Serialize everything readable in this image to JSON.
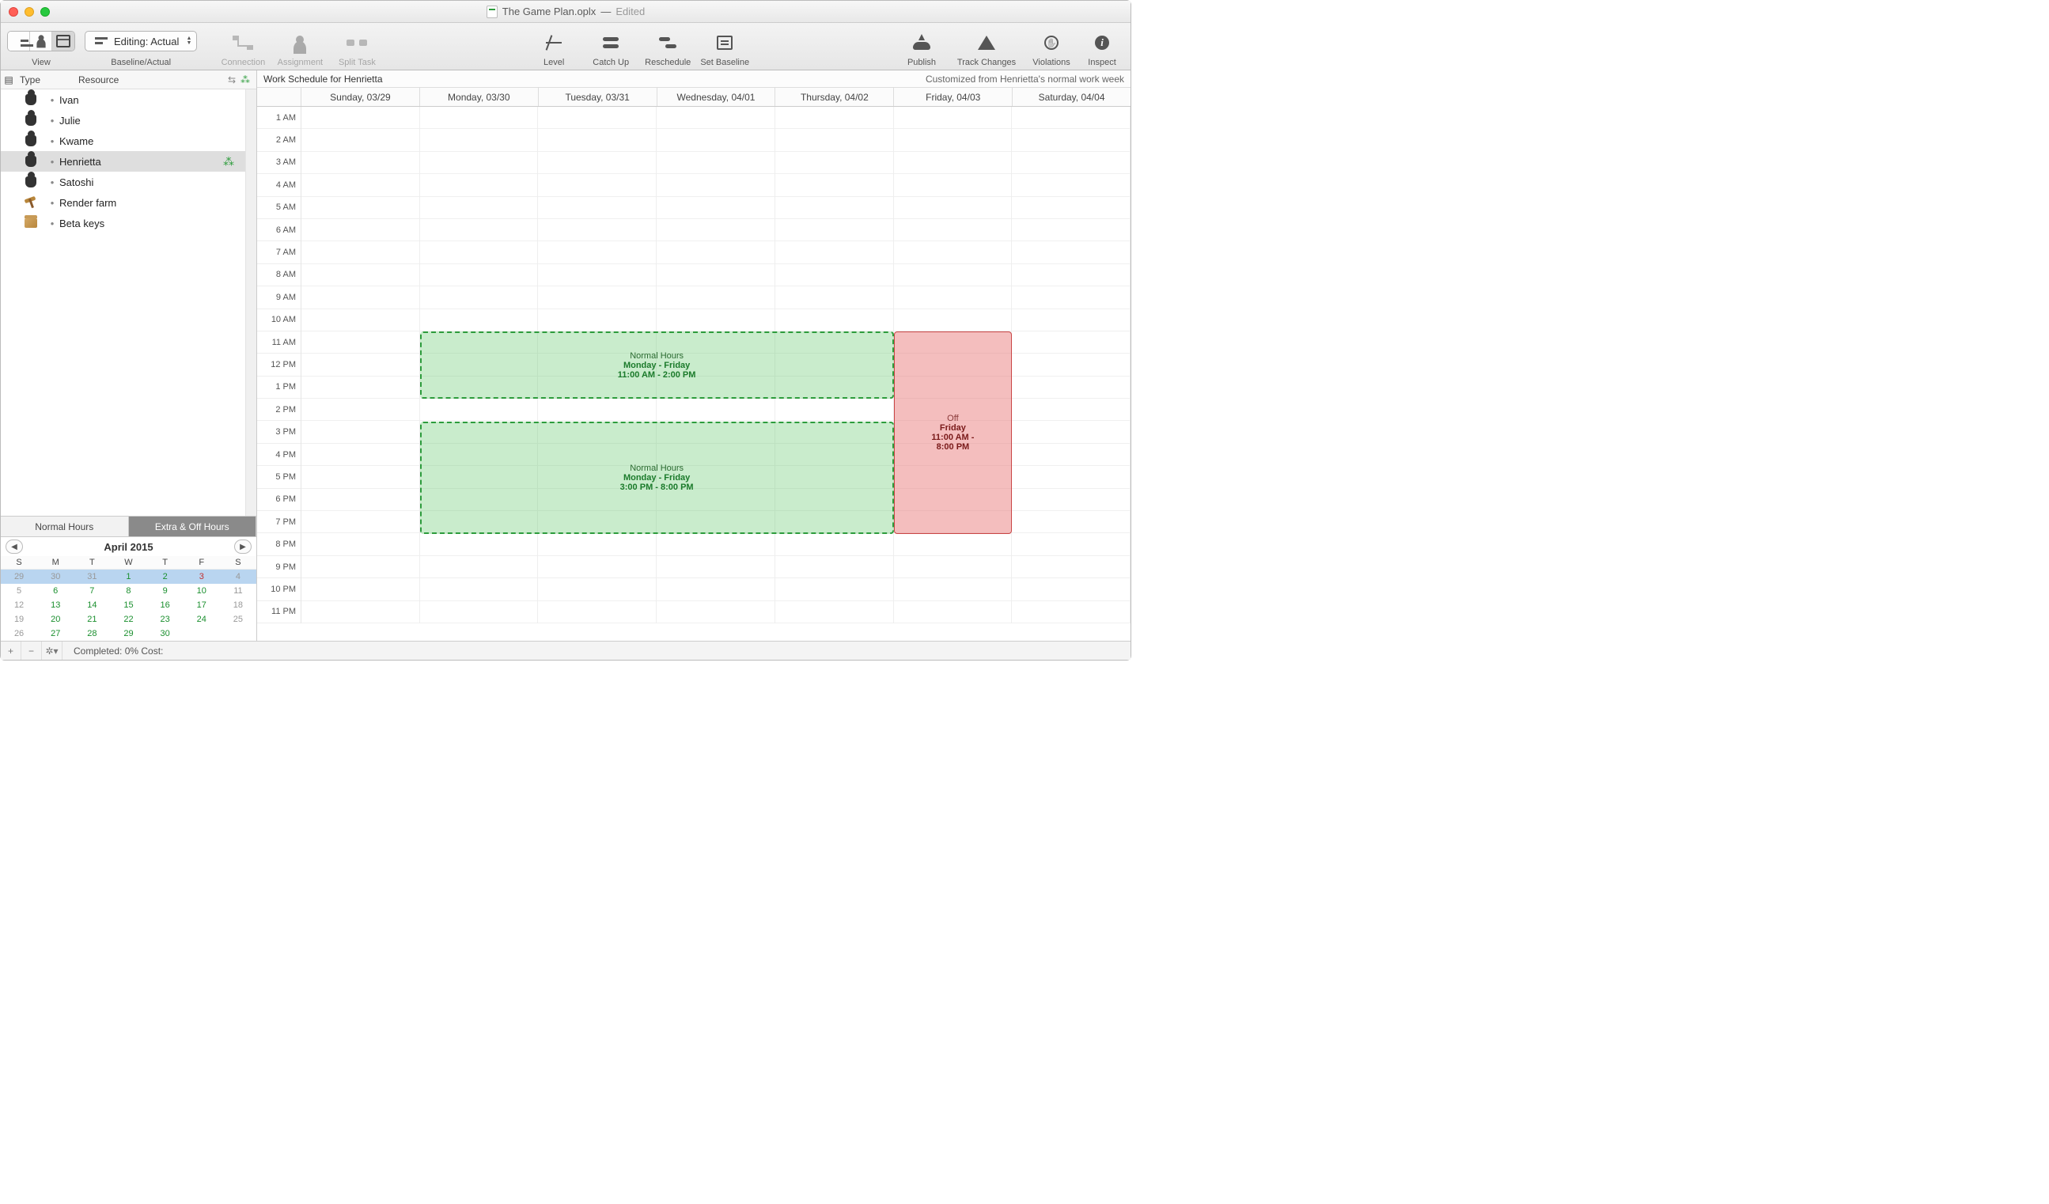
{
  "window": {
    "title": "The Game Plan.oplx",
    "edited": "Edited"
  },
  "toolbar": {
    "view_label": "View",
    "baseline_actual_label": "Baseline/Actual",
    "editing_actual": "Editing: Actual",
    "connection": "Connection",
    "assignment": "Assignment",
    "split_task": "Split Task",
    "level": "Level",
    "catch_up": "Catch Up",
    "reschedule": "Reschedule",
    "set_baseline": "Set Baseline",
    "publish": "Publish",
    "track_changes": "Track Changes",
    "violations": "Violations",
    "inspect": "Inspect"
  },
  "sidebar": {
    "col_type": "Type",
    "col_resource": "Resource",
    "resources": [
      {
        "name": "Ivan",
        "type": "person"
      },
      {
        "name": "Julie",
        "type": "person"
      },
      {
        "name": "Kwame",
        "type": "person"
      },
      {
        "name": "Henrietta",
        "type": "person",
        "selected": true,
        "badge": true
      },
      {
        "name": "Satoshi",
        "type": "person"
      },
      {
        "name": "Render farm",
        "type": "equipment"
      },
      {
        "name": "Beta keys",
        "type": "material"
      }
    ]
  },
  "hours_tabs": {
    "normal": "Normal Hours",
    "extra": "Extra & Off Hours"
  },
  "mini_calendar": {
    "month": "April 2015",
    "dow": [
      "S",
      "M",
      "T",
      "W",
      "T",
      "F",
      "S"
    ],
    "rows": [
      [
        {
          "d": "29"
        },
        {
          "d": "30"
        },
        {
          "d": "31"
        },
        {
          "d": "1",
          "c": "g"
        },
        {
          "d": "2",
          "c": "g"
        },
        {
          "d": "3",
          "c": "r"
        },
        {
          "d": "4"
        }
      ],
      [
        {
          "d": "5"
        },
        {
          "d": "6",
          "c": "g"
        },
        {
          "d": "7",
          "c": "g"
        },
        {
          "d": "8",
          "c": "g"
        },
        {
          "d": "9",
          "c": "g"
        },
        {
          "d": "10",
          "c": "g"
        },
        {
          "d": "11"
        }
      ],
      [
        {
          "d": "12"
        },
        {
          "d": "13",
          "c": "g"
        },
        {
          "d": "14",
          "c": "g"
        },
        {
          "d": "15",
          "c": "g"
        },
        {
          "d": "16",
          "c": "g"
        },
        {
          "d": "17",
          "c": "g"
        },
        {
          "d": "18"
        }
      ],
      [
        {
          "d": "19"
        },
        {
          "d": "20",
          "c": "g"
        },
        {
          "d": "21",
          "c": "g"
        },
        {
          "d": "22",
          "c": "g"
        },
        {
          "d": "23",
          "c": "g"
        },
        {
          "d": "24",
          "c": "g"
        },
        {
          "d": "25"
        }
      ],
      [
        {
          "d": "26"
        },
        {
          "d": "27",
          "c": "g"
        },
        {
          "d": "28",
          "c": "g"
        },
        {
          "d": "29",
          "c": "g"
        },
        {
          "d": "30",
          "c": "g"
        },
        {
          "d": ""
        },
        {
          "d": ""
        }
      ]
    ]
  },
  "main": {
    "header_left": "Work Schedule for Henrietta",
    "header_right": "Customized from Henrietta's normal work week",
    "days": [
      "Sunday, 03/29",
      "Monday, 03/30",
      "Tuesday, 03/31",
      "Wednesday, 04/01",
      "Thursday, 04/02",
      "Friday, 04/03",
      "Saturday, 04/04"
    ],
    "hours": [
      "1 AM",
      "2 AM",
      "3 AM",
      "4 AM",
      "5 AM",
      "6 AM",
      "7 AM",
      "8 AM",
      "9 AM",
      "10 AM",
      "11 AM",
      "12 PM",
      "1 PM",
      "2 PM",
      "3 PM",
      "4 PM",
      "5 PM",
      "6 PM",
      "7 PM",
      "8 PM",
      "9 PM",
      "10 PM",
      "11 PM"
    ]
  },
  "blocks": {
    "nh1_title": "Normal Hours",
    "nh1_days": "Monday - Friday",
    "nh1_time": "11:00 AM - 2:00 PM",
    "nh2_title": "Normal Hours",
    "nh2_days": "Monday - Friday",
    "nh2_time": "3:00 PM - 8:00 PM",
    "off_title": "Off",
    "off_days": "Friday",
    "off_time1": "11:00 AM -",
    "off_time2": "8:00 PM"
  },
  "footer": {
    "status": "Completed: 0% Cost:"
  }
}
